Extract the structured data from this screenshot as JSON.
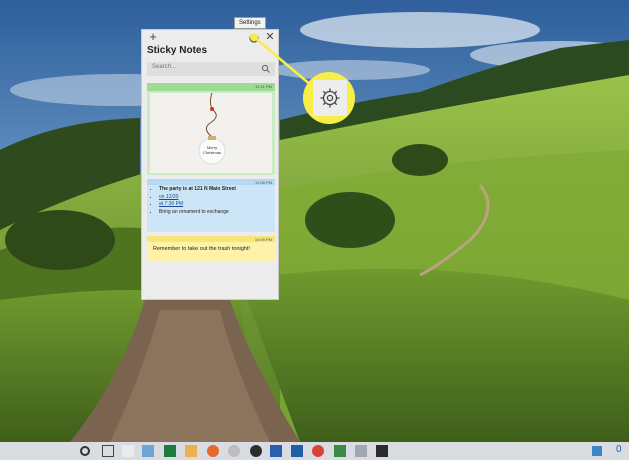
{
  "app": {
    "title": "Sticky Notes",
    "tooltip": "Settings",
    "plus_label": "+",
    "close_label": "✕"
  },
  "search": {
    "placeholder": "Search..."
  },
  "notes": [
    {
      "color": "green",
      "time": "12:11 PM",
      "image_text": "Merry Christmas"
    },
    {
      "color": "blue",
      "time": "11:08 PM",
      "items": [
        "The party is at 121 N Main Street",
        "on 12/20",
        "at 7:30 PM",
        "Bring an ornament to exchange"
      ]
    },
    {
      "color": "yellow",
      "time": "10:09 PM",
      "text": "Remember to take out the trash tonight!"
    }
  ],
  "icons": {
    "plus": "plus-icon",
    "gear": "gear-icon",
    "close": "close-icon",
    "search": "search-icon"
  },
  "taskbar": {
    "tray_text": "0",
    "apps": [
      "cortana",
      "task-view",
      "edge",
      "excel",
      "file-explorer",
      "firefox",
      "chrome",
      "photos",
      "word",
      "outlook",
      "chrome-alt",
      "security",
      "paint",
      "terminal"
    ]
  },
  "colors": {
    "note_green": "#c9ecc4",
    "note_blue": "#cde6f7",
    "note_yellow": "#fdf2a8",
    "callout": "#f7ef47"
  }
}
